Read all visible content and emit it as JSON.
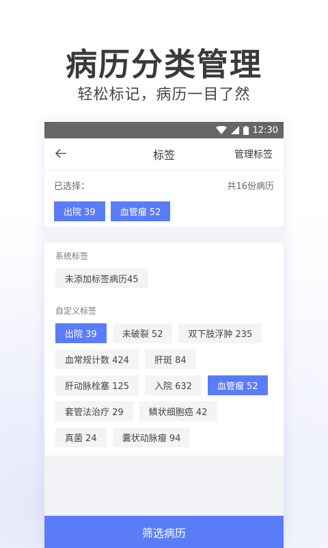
{
  "promo": {
    "title": "病历分类管理",
    "subtitle": "轻松标记，病历一目了然"
  },
  "status_bar": {
    "time": "12:30"
  },
  "nav": {
    "title": "标签",
    "manage_label": "管理标签"
  },
  "selected": {
    "label": "已选择：",
    "total": "共16份病历",
    "tags": [
      "出院 39",
      "血管瘤 52"
    ]
  },
  "system_group": {
    "label": "系统标签",
    "tags": [
      "未添加标签病历45"
    ]
  },
  "custom_group": {
    "label": "自定义标签",
    "tags": [
      {
        "text": "出院 39",
        "active": true
      },
      {
        "text": "未破裂 52",
        "active": false
      },
      {
        "text": "双下肢浮肿 235",
        "active": false
      },
      {
        "text": "血常规计数 424",
        "active": false
      },
      {
        "text": "肝斑 84",
        "active": false
      },
      {
        "text": "肝动脉栓塞 125",
        "active": false
      },
      {
        "text": "入院 632",
        "active": false
      },
      {
        "text": "血管瘤 52",
        "active": true
      },
      {
        "text": "套管法治疗 29",
        "active": false
      },
      {
        "text": "鳞状细胞癌 42",
        "active": false
      },
      {
        "text": "真菌 24",
        "active": false
      },
      {
        "text": "囊状动脉瘤 94",
        "active": false
      }
    ]
  },
  "filter_button": "筛选病历",
  "colors": {
    "accent": "#5a7df7",
    "status_bar": "#666666"
  }
}
